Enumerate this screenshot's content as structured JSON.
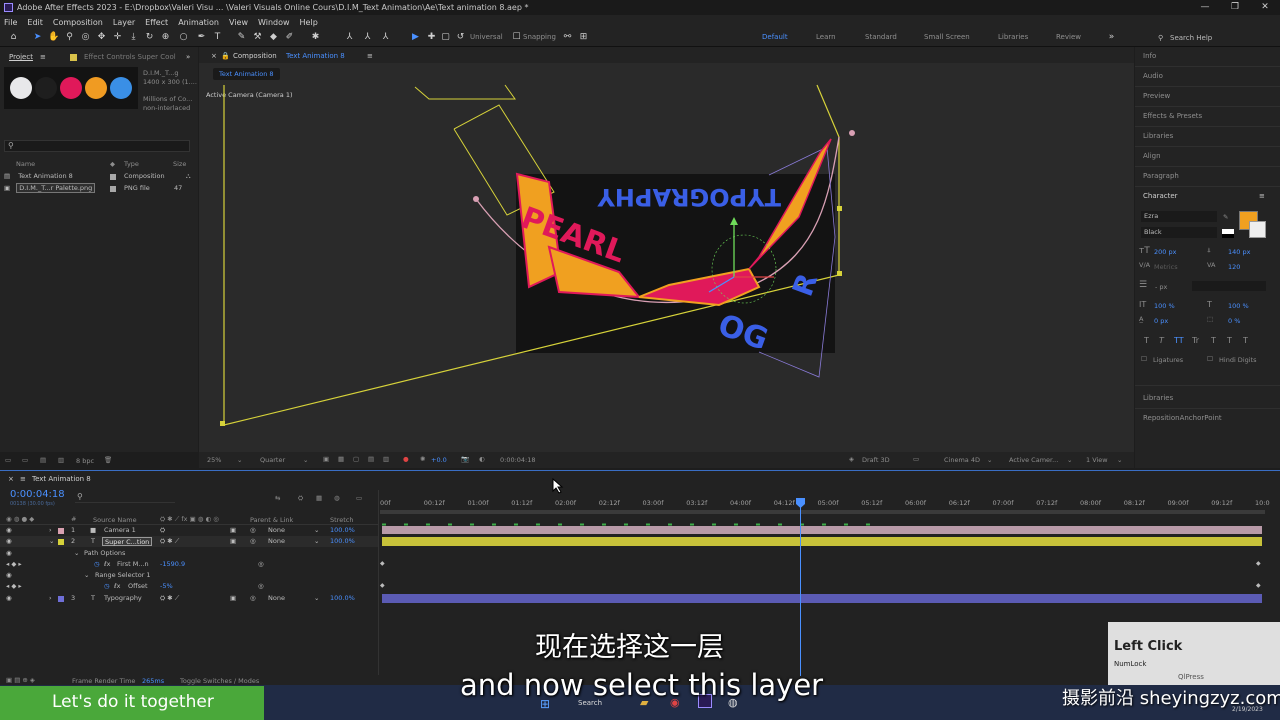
{
  "window": {
    "title": "Adobe After Effects 2023 - E:\\Dropbox\\Valeri Visu ... \\Valeri Visuals Online Cours\\D.I.M_Text Animation\\Ae\\Text animation 8.aep *",
    "minimize": "—",
    "maximize": "❐",
    "close": "✕"
  },
  "menu": [
    "File",
    "Edit",
    "Composition",
    "Layer",
    "Effect",
    "Animation",
    "View",
    "Window",
    "Help"
  ],
  "toolbar": {
    "universal_label": "Universal",
    "snapping_label": "Snapping",
    "workspaces": [
      "Default",
      "Learn",
      "Standard",
      "Small Screen",
      "Libraries",
      "Review"
    ],
    "active_workspace": "Default",
    "search_help": "Search Help",
    "more": "»"
  },
  "project_panel": {
    "tab_project": "Project",
    "tab_effect_controls": "Effect Controls Super Cool",
    "expand": "»",
    "preview_name": "D.I.M._T...g",
    "preview_size": "1400 x 300 (1....",
    "preview_colors": "Millions of Co...",
    "preview_interlace": "non-interlaced",
    "swatch_colors": [
      "#e8e8ea",
      "#1e1e1e",
      "#e0195a",
      "#f09b22",
      "#3a8fe6"
    ],
    "col_name": "Name",
    "col_type": "Type",
    "col_size": "Size",
    "items": [
      {
        "name": "Text Animation 8",
        "type": "Composition",
        "size": ""
      },
      {
        "name": "D.I.M._T...r Palette.png",
        "type": "PNG file",
        "size": "47"
      }
    ],
    "bpc": "8 bpc"
  },
  "comp_panel": {
    "tab_label": "Composition",
    "comp_name": "Text Animation 8",
    "sub_tab": "Text Animation 8",
    "camera_label": "Active Camera (Camera 1)",
    "zoom": "25%",
    "resolution": "Quarter",
    "exposure": "+0.0",
    "timecode": "0:00:04:18",
    "renderer": "Draft 3D",
    "engine": "Cinema 4D",
    "view": "Active Camer...",
    "views": "1 View",
    "art_letters": "PEARL",
    "art_ring": "TYPOGRAPHY"
  },
  "right_panel": {
    "items": [
      "Info",
      "Audio",
      "Preview",
      "Effects & Presets",
      "Libraries",
      "Align",
      "Paragraph",
      "Character"
    ],
    "font": "Ezra",
    "style": "Black",
    "font_size": "200 px",
    "leading": "140 px",
    "tracking": "120",
    "kerning": "Metrics",
    "stroke_unit": "- px",
    "vscale": "100 %",
    "hscale": "100 %",
    "baseline": "0 px",
    "tsume": "0 %",
    "ligatures": "Ligatures",
    "hindi_digits": "Hindi Digits",
    "fill_color": "#f0a020",
    "libraries": "Libraries",
    "reposition": "RepositionAnchorPoint",
    "type_styles": [
      "T",
      "T",
      "TT",
      "Tr",
      "T",
      "T",
      "T"
    ]
  },
  "timeline": {
    "tab": "Text Animation 8",
    "timecode": "0:00:04:18",
    "frame_info": "00138 (30.00 fps)",
    "col_source": "Source Name",
    "col_parent": "Parent & Link",
    "col_stretch": "Stretch",
    "ruler": [
      "00f",
      "00:12f",
      "01:00f",
      "01:12f",
      "02:00f",
      "02:12f",
      "03:00f",
      "03:12f",
      "04:00f",
      "04:12f",
      "05:00f",
      "05:12f",
      "06:00f",
      "06:12f",
      "07:00f",
      "07:12f",
      "08:00f",
      "08:12f",
      "09:00f",
      "09:12f",
      "10:0"
    ],
    "layers": [
      {
        "num": "1",
        "name": "Camera 1",
        "parent": "None",
        "stretch": "100.0%"
      },
      {
        "num": "2",
        "name": "Super C...tion",
        "parent": "None",
        "stretch": "100.0%"
      },
      {
        "num": "3",
        "name": "Typography",
        "parent": "None",
        "stretch": "100.0%"
      }
    ],
    "path_options": "Path Options",
    "first_margin_label": "First M...n",
    "first_margin_value": "-1590.9",
    "range_selector": "Range Selector 1",
    "offset_label": "Offset",
    "offset_value": "-5%",
    "frame_render_label": "Frame Render Time",
    "frame_render_value": "265ms",
    "toggle_label": "Toggle Switches / Modes"
  },
  "overlay": {
    "left_click": "Left Click",
    "numlock": "NumLock",
    "qiipress": "QlPress",
    "cta": "Let's do it together",
    "subtitle_cn": "现在选择这一层",
    "subtitle_en": "and now select this layer",
    "watermark": "摄影前沿 sheyingzyz.com",
    "taskbar_search": "Search",
    "date": "2/19/2023"
  }
}
